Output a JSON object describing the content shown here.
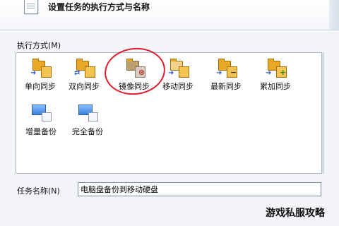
{
  "header": {
    "title": "设置任务的执行方式与名称"
  },
  "execution": {
    "label": "执行方式(M)",
    "items": [
      {
        "label": "单向同步",
        "icon": "one-way-sync-icon"
      },
      {
        "label": "双向同步",
        "icon": "two-way-sync-icon"
      },
      {
        "label": "镜像同步",
        "icon": "mirror-sync-icon"
      },
      {
        "label": "移动同步",
        "icon": "move-sync-icon"
      },
      {
        "label": "最新同步",
        "icon": "latest-sync-icon"
      },
      {
        "label": "累加同步",
        "icon": "incremental-sync-icon"
      },
      {
        "label": "增量备份",
        "icon": "incremental-backup-icon"
      },
      {
        "label": "完全备份",
        "icon": "full-backup-icon"
      }
    ]
  },
  "task_name": {
    "label": "任务名称(N)",
    "value": "电脑盘备份到移动硬盘"
  },
  "watermark": "游戏私服攻略"
}
